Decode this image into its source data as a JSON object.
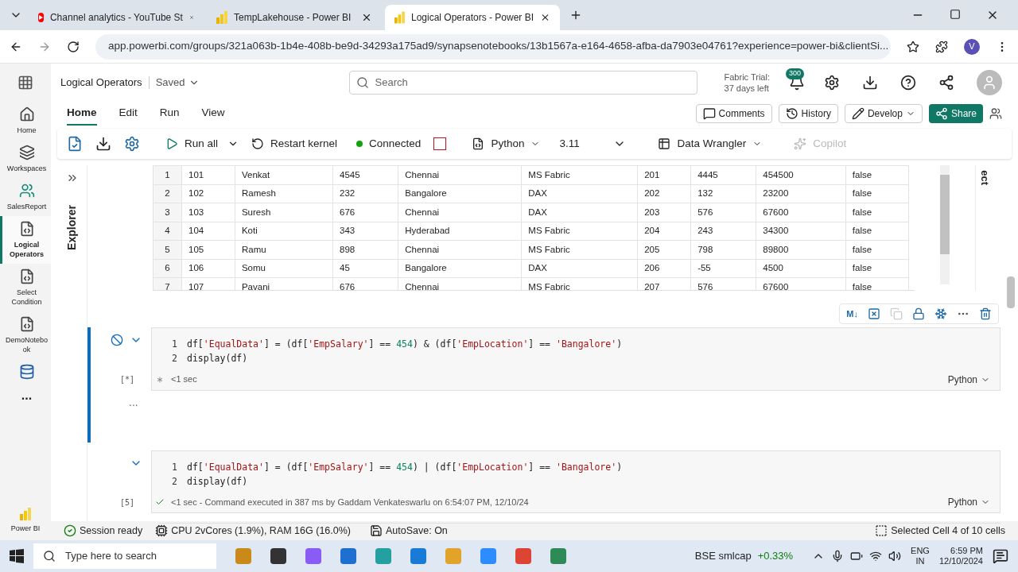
{
  "browser": {
    "tabs": [
      {
        "title": "Channel analytics - YouTube St",
        "kind": "youtube",
        "selected": false
      },
      {
        "title": "TempLakehouse - Power BI",
        "kind": "powerbi",
        "selected": false
      },
      {
        "title": "Logical Operators - Power BI",
        "kind": "powerbi",
        "selected": true
      }
    ],
    "address": "app.powerbi.com/groups/321a063b-1b4e-408b-be9d-34293a175ad9/synapsenotebooks/13b1567a-e164-4658-afba-da7903e04761?experience=power-bi&clientSi...",
    "profile": "V"
  },
  "header": {
    "title": "Logical Operators",
    "status": "Saved",
    "search_placeholder": "Search",
    "trial": [
      "Fabric Trial:",
      "37 days left"
    ],
    "notification_count": "300"
  },
  "ribbon": {
    "tabs": [
      {
        "label": "Home",
        "selected": true
      },
      {
        "label": "Edit",
        "selected": false
      },
      {
        "label": "Run",
        "selected": false
      },
      {
        "label": "View",
        "selected": false
      }
    ],
    "actions": [
      "Comments",
      "History",
      "Develop",
      "Share"
    ]
  },
  "toolbar": {
    "run_all": "Run all",
    "restart": "Restart kernel",
    "connection": "Connected",
    "language": "Python",
    "version": "3.11",
    "wrangler": "Data Wrangler",
    "copilot": "Copilot"
  },
  "nav": [
    {
      "label": "Home",
      "kind": "home",
      "selected": false
    },
    {
      "label": "Workspaces",
      "kind": "workspaces",
      "selected": false
    },
    {
      "label": "SalesReport",
      "kind": "people",
      "selected": false
    },
    {
      "label": "Logical Operators",
      "kind": "notebook",
      "selected": true
    },
    {
      "label": "Select Condition",
      "kind": "notebook",
      "selected": false
    },
    {
      "label": "DemoNotebook",
      "kind": "notebook",
      "selected": false
    },
    {
      "kind": "lakehouse",
      "selected": false
    },
    {
      "label": "...",
      "kind": "more",
      "selected": false
    }
  ],
  "nav_footer": "Power BI",
  "explorer": {
    "label": "Explorer"
  },
  "side_label": "ect",
  "table": {
    "rows": [
      {
        "index": "1",
        "cells": [
          "101",
          "Venkat",
          "4545",
          "Chennai",
          "MS Fabric",
          "201",
          "4445",
          "454500",
          "false"
        ]
      },
      {
        "index": "2",
        "cells": [
          "102",
          "Ramesh",
          "232",
          "Bangalore",
          "DAX",
          "202",
          "132",
          "23200",
          "false"
        ]
      },
      {
        "index": "3",
        "cells": [
          "103",
          "Suresh",
          "676",
          "Chennai",
          "DAX",
          "203",
          "576",
          "67600",
          "false"
        ]
      },
      {
        "index": "4",
        "cells": [
          "104",
          "Koti",
          "343",
          "Hyderabad",
          "MS Fabric",
          "204",
          "243",
          "34300",
          "false"
        ]
      },
      {
        "index": "5",
        "cells": [
          "105",
          "Ramu",
          "898",
          "Chennai",
          "MS Fabric",
          "205",
          "798",
          "89800",
          "false"
        ]
      },
      {
        "index": "6",
        "cells": [
          "106",
          "Somu",
          "45",
          "Bangalore",
          "DAX",
          "206",
          "-55",
          "4500",
          "false"
        ]
      },
      {
        "index": "7",
        "cells": [
          "107",
          "Pavani",
          "676",
          "Chennai",
          "MS Fabric",
          "207",
          "576",
          "67600",
          "false"
        ]
      }
    ]
  },
  "cell_toolbar": {
    "markdown": "M↓"
  },
  "cells": [
    {
      "selected": true,
      "running": true,
      "exec": "[*]",
      "status": "<1 sec",
      "language": "Python",
      "output": "...",
      "lines": [
        {
          "number": "1",
          "tokens": [
            {
              "kind": "plain",
              "text": "df["
            },
            {
              "kind": "string",
              "text": "'EqualData'"
            },
            {
              "kind": "plain",
              "text": "] = (df["
            },
            {
              "kind": "string",
              "text": "'EmpSalary'"
            },
            {
              "kind": "plain",
              "text": "] == "
            },
            {
              "kind": "number",
              "text": "454"
            },
            {
              "kind": "plain",
              "text": ") & (df["
            },
            {
              "kind": "string",
              "text": "'EmpLocation'"
            },
            {
              "kind": "plain",
              "text": "] == "
            },
            {
              "kind": "string",
              "text": "'Bangalore'"
            },
            {
              "kind": "plain",
              "text": ")"
            }
          ]
        },
        {
          "number": "2",
          "tokens": [
            {
              "kind": "plain",
              "text": "display(df)"
            }
          ]
        }
      ]
    },
    {
      "selected": false,
      "running": false,
      "exec": "[5]",
      "status": "<1 sec - Command executed in 387 ms by Gaddam Venkateswarlu on 6:54:07 PM, 12/10/24",
      "language": "Python",
      "lines": [
        {
          "number": "1",
          "tokens": [
            {
              "kind": "plain",
              "text": "df["
            },
            {
              "kind": "string",
              "text": "'EqualData'"
            },
            {
              "kind": "plain",
              "text": "] = (df["
            },
            {
              "kind": "string",
              "text": "'EmpSalary'"
            },
            {
              "kind": "plain",
              "text": "] == "
            },
            {
              "kind": "number",
              "text": "454"
            },
            {
              "kind": "plain",
              "text": ") | (df["
            },
            {
              "kind": "string",
              "text": "'EmpLocation'"
            },
            {
              "kind": "plain",
              "text": "] == "
            },
            {
              "kind": "string",
              "text": "'Bangalore'"
            },
            {
              "kind": "plain",
              "text": ")"
            }
          ]
        },
        {
          "number": "2",
          "tokens": [
            {
              "kind": "plain",
              "text": "display(df)"
            }
          ]
        }
      ]
    }
  ],
  "status_bar": {
    "session": "Session ready",
    "resources": "CPU 2vCores (1.9%), RAM 16G (16.0%)",
    "autosave": "AutoSave: On",
    "selection": "Selected Cell 4 of 10 cells"
  },
  "taskbar": {
    "search_placeholder": "Type here to search",
    "ticker": "BSE smlcap",
    "change": "+0.33%",
    "lang": [
      "ENG",
      "IN"
    ],
    "time": "6:59 PM",
    "date": "12/10/2024"
  }
}
